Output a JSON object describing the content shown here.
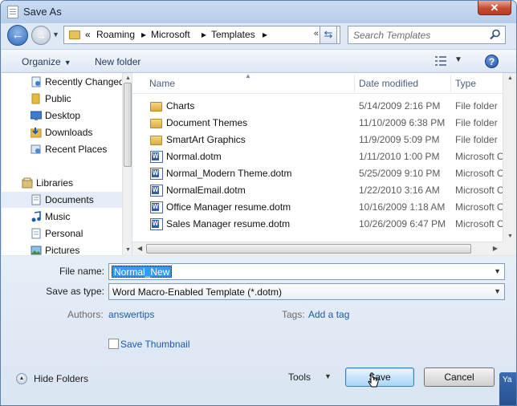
{
  "window": {
    "title": "Save As",
    "close_glyph": "✕"
  },
  "nav": {
    "back_icon": "back-arrow-icon",
    "forward_icon": "forward-arrow-icon",
    "breadcrumb": [
      "«",
      "Roaming",
      "▸",
      "Microsoft",
      "▸",
      "Templates",
      "▸"
    ],
    "overflow": "«"
  },
  "search": {
    "placeholder": "Search Templates"
  },
  "toolbar": {
    "organize_label": "Organize",
    "new_folder_label": "New folder",
    "help_label": "?"
  },
  "sidebar": {
    "items": [
      {
        "label": "Recently Changed",
        "icon": "recent-icon",
        "selected": false
      },
      {
        "label": "Public",
        "icon": "folder-icon",
        "selected": false
      },
      {
        "label": "Desktop",
        "icon": "desktop-icon",
        "selected": false
      },
      {
        "label": "Downloads",
        "icon": "downloads-icon",
        "selected": false
      },
      {
        "label": "Recent Places",
        "icon": "recent-places-icon",
        "selected": false
      },
      {
        "label": "Libraries",
        "icon": "libraries-icon",
        "selected": false
      },
      {
        "label": "Documents",
        "icon": "documents-icon",
        "selected": true
      },
      {
        "label": "Music",
        "icon": "music-icon",
        "selected": false
      },
      {
        "label": "Personal",
        "icon": "personal-icon",
        "selected": false
      },
      {
        "label": "Pictures",
        "icon": "pictures-icon",
        "selected": false
      }
    ]
  },
  "files": {
    "columns": {
      "name": "Name",
      "date": "Date modified",
      "type": "Type"
    },
    "rows": [
      {
        "name": "Charts",
        "date": "5/14/2009 2:16 PM",
        "type": "File folder",
        "icon": "folder-icon"
      },
      {
        "name": "Document Themes",
        "date": "11/10/2009 6:38 PM",
        "type": "File folder",
        "icon": "folder-icon"
      },
      {
        "name": "SmartArt Graphics",
        "date": "11/9/2009 5:09 PM",
        "type": "File folder",
        "icon": "folder-icon"
      },
      {
        "name": "Normal.dotm",
        "date": "1/11/2010 1:00 PM",
        "type": "Microsoft Of",
        "icon": "word-template-icon"
      },
      {
        "name": "Normal_Modern Theme.dotm",
        "date": "5/25/2009 9:10 PM",
        "type": "Microsoft Of",
        "icon": "word-template-icon"
      },
      {
        "name": "NormalEmail.dotm",
        "date": "1/22/2010 3:16 AM",
        "type": "Microsoft Of",
        "icon": "word-template-icon"
      },
      {
        "name": "Office Manager resume.dotm",
        "date": "10/16/2009 1:18 AM",
        "type": "Microsoft Of",
        "icon": "word-template-icon"
      },
      {
        "name": "Sales Manager resume.dotm",
        "date": "10/26/2009 6:47 PM",
        "type": "Microsoft Of",
        "icon": "word-template-icon"
      }
    ]
  },
  "form": {
    "file_name_label": "File name:",
    "file_name_value": "Normal_New",
    "save_type_label": "Save as type:",
    "save_type_value": "Word Macro-Enabled Template (*.dotm)",
    "authors_label": "Authors:",
    "authors_value": "answertips",
    "tags_label": "Tags:",
    "tags_value": "Add a tag",
    "thumbnail_label": "Save Thumbnail",
    "thumbnail_checked": false
  },
  "footer": {
    "hide_folders_label": "Hide Folders",
    "tools_label": "Tools",
    "save_label": "Save",
    "cancel_label": "Cancel"
  },
  "edge_tab": {
    "label": "Ya"
  }
}
